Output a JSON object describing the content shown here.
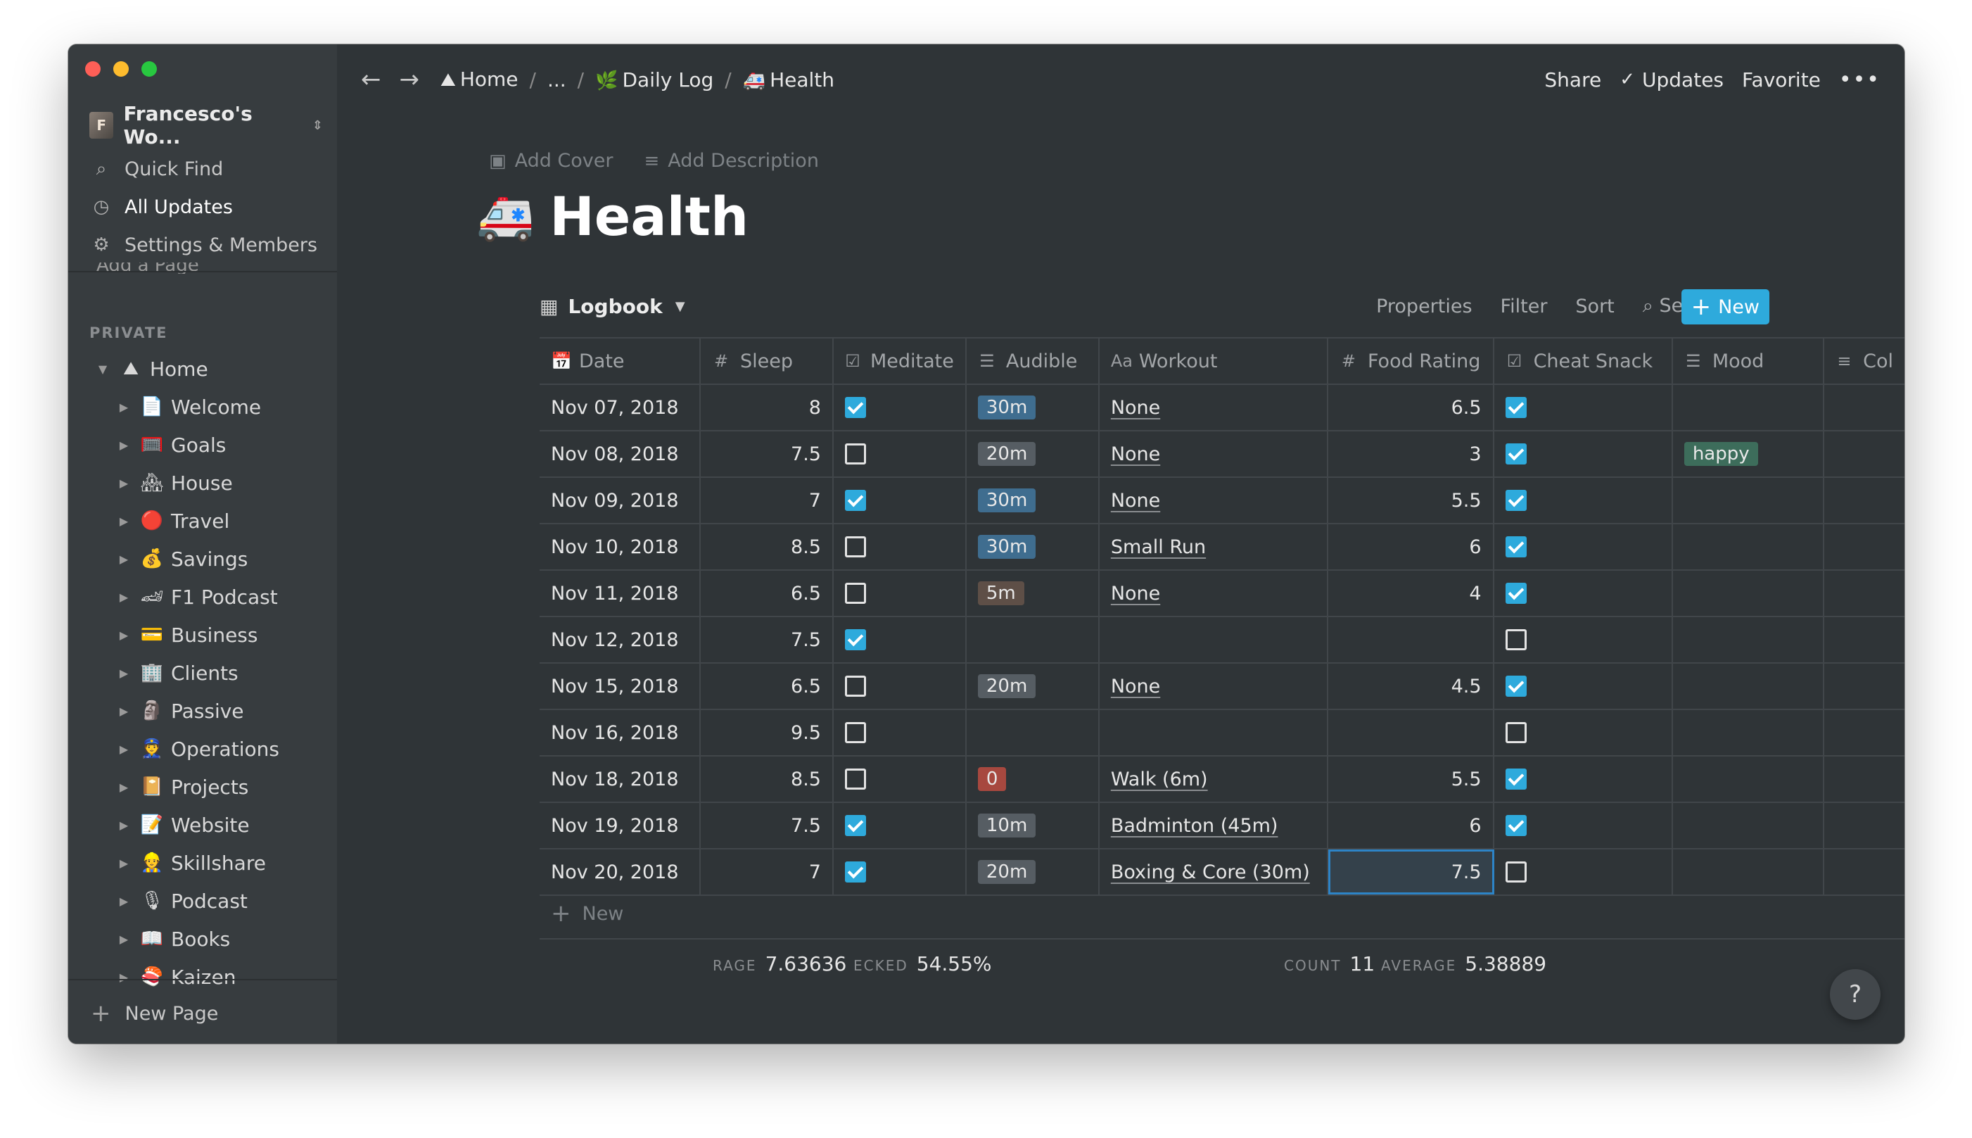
{
  "workspace": {
    "name": "Francesco's Wo...",
    "chevron": "⌃"
  },
  "sidebar": {
    "top": [
      {
        "icon": "search-icon",
        "label": "Quick Find"
      },
      {
        "icon": "clock-icon",
        "label": "All Updates"
      },
      {
        "icon": "gear-icon",
        "label": "Settings & Members"
      }
    ],
    "cutoff_item": "Add a Page",
    "section_label": "PRIVATE",
    "tree": [
      {
        "emoji": "⛰",
        "label": "Home",
        "root": true,
        "expanded": true
      },
      {
        "emoji": "📄",
        "label": "Welcome"
      },
      {
        "emoji": "🥅",
        "label": "Goals"
      },
      {
        "emoji": "🏘",
        "label": "House"
      },
      {
        "emoji": "🔴",
        "label": "Travel"
      },
      {
        "emoji": "💰",
        "label": "Savings"
      },
      {
        "emoji": "🏎",
        "label": "F1 Podcast"
      },
      {
        "emoji": "💳",
        "label": "Business"
      },
      {
        "emoji": "🏢",
        "label": "Clients"
      },
      {
        "emoji": "🗿",
        "label": "Passive"
      },
      {
        "emoji": "👮",
        "label": "Operations"
      },
      {
        "emoji": "📔",
        "label": "Projects"
      },
      {
        "emoji": "📝",
        "label": "Website"
      },
      {
        "emoji": "👷",
        "label": "Skillshare"
      },
      {
        "emoji": "🎙",
        "label": "Podcast"
      },
      {
        "emoji": "📖",
        "label": "Books"
      },
      {
        "emoji": "🍣",
        "label": "Kaizen"
      }
    ],
    "new_page": "New Page"
  },
  "topbar": {
    "crumbs": [
      {
        "emoji": "⛰",
        "label": "Home"
      },
      {
        "emoji": "",
        "label": "..."
      },
      {
        "emoji": "🌿",
        "label": "Daily Log"
      },
      {
        "emoji": "🚑",
        "label": "Health"
      }
    ],
    "share": "Share",
    "updates": "Updates",
    "favorite": "Favorite"
  },
  "page": {
    "add_cover": "Add Cover",
    "add_description": "Add Description",
    "emoji": "🚑",
    "title": "Health"
  },
  "view": {
    "name": "Logbook",
    "properties": "Properties",
    "filter": "Filter",
    "sort": "Sort",
    "search": "Search",
    "new": "New"
  },
  "columns": [
    {
      "icon": "📅",
      "label": "Date",
      "cls": "c-date"
    },
    {
      "icon": "#",
      "label": "Sleep",
      "cls": "c-sleep"
    },
    {
      "icon": "☑",
      "label": "Meditate",
      "cls": "c-med"
    },
    {
      "icon": "☰",
      "label": "Audible",
      "cls": "c-aud"
    },
    {
      "icon": "Aa",
      "label": "Workout",
      "cls": "c-work"
    },
    {
      "icon": "#",
      "label": "Food Rating",
      "cls": "c-food"
    },
    {
      "icon": "☑",
      "label": "Cheat Snack",
      "cls": "c-cheat"
    },
    {
      "icon": "☰",
      "label": "Mood",
      "cls": "c-mood"
    },
    {
      "icon": "≡",
      "label": "Col",
      "cls": "c-col"
    }
  ],
  "tag_colors": {
    "30m": "#3f6d8f",
    "20m": "#565d63",
    "10m": "#565d63",
    "5m": "#5e4f47",
    "0": "#a7483f",
    "happy": "#3d6d5b"
  },
  "rows": [
    {
      "date": "Nov 07, 2018",
      "sleep": "8",
      "meditate": true,
      "audible": "30m",
      "workout": "None",
      "food": "6.5",
      "cheat": true,
      "mood": ""
    },
    {
      "date": "Nov 08, 2018",
      "sleep": "7.5",
      "meditate": false,
      "audible": "20m",
      "workout": "None",
      "food": "3",
      "cheat": true,
      "mood": "happy"
    },
    {
      "date": "Nov 09, 2018",
      "sleep": "7",
      "meditate": true,
      "audible": "30m",
      "workout": "None",
      "food": "5.5",
      "cheat": true,
      "mood": ""
    },
    {
      "date": "Nov 10, 2018",
      "sleep": "8.5",
      "meditate": false,
      "audible": "30m",
      "workout": "Small Run",
      "food": "6",
      "cheat": true,
      "mood": ""
    },
    {
      "date": "Nov 11, 2018",
      "sleep": "6.5",
      "meditate": false,
      "audible": "5m",
      "workout": "None",
      "food": "4",
      "cheat": true,
      "mood": ""
    },
    {
      "date": "Nov 12, 2018",
      "sleep": "7.5",
      "meditate": true,
      "audible": "",
      "workout": "",
      "food": "",
      "cheat": false,
      "mood": ""
    },
    {
      "date": "Nov 15, 2018",
      "sleep": "6.5",
      "meditate": false,
      "audible": "20m",
      "workout": "None",
      "food": "4.5",
      "cheat": true,
      "mood": ""
    },
    {
      "date": "Nov 16, 2018",
      "sleep": "9.5",
      "meditate": false,
      "audible": "",
      "workout": "",
      "food": "",
      "cheat": false,
      "mood": ""
    },
    {
      "date": "Nov 18, 2018",
      "sleep": "8.5",
      "meditate": false,
      "audible": "0",
      "workout": "Walk (6m)",
      "food": "5.5",
      "cheat": true,
      "mood": ""
    },
    {
      "date": "Nov 19, 2018",
      "sleep": "7.5",
      "meditate": true,
      "audible": "10m",
      "workout": "Badminton (45m)",
      "food": "6",
      "cheat": true,
      "mood": ""
    },
    {
      "date": "Nov 20, 2018",
      "sleep": "7",
      "meditate": true,
      "audible": "20m",
      "workout": "Boxing & Core (30m)",
      "food": "7.5",
      "cheat": false,
      "mood": "",
      "selected_food": true
    }
  ],
  "new_row": "New",
  "calc": {
    "sleep_label": "RAGE",
    "sleep_value": "7.63636",
    "med_label": "ECKED",
    "med_value": "54.55%",
    "count_label": "COUNT",
    "count_value": "11",
    "avg_label": "AVERAGE",
    "avg_value": "5.38889"
  },
  "help": "?"
}
